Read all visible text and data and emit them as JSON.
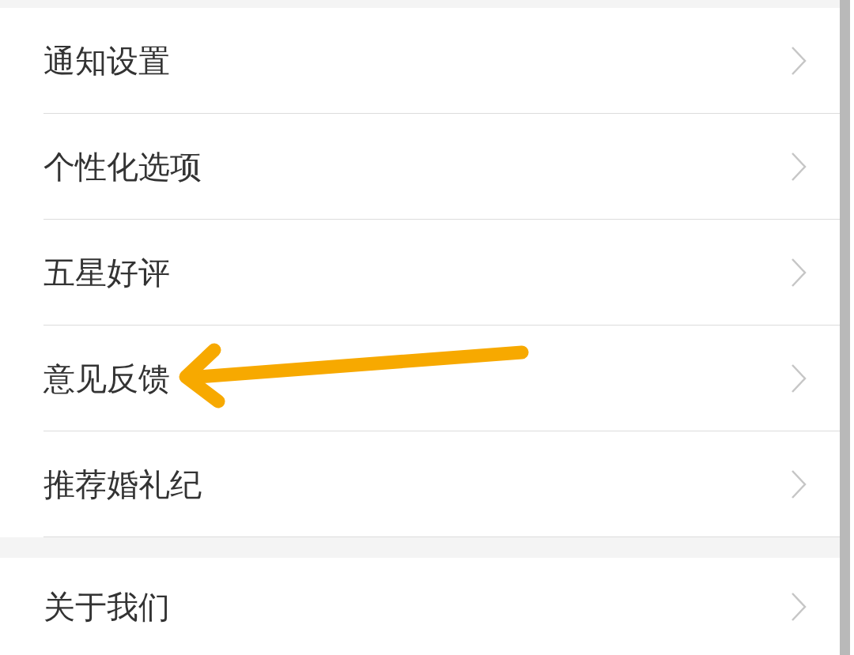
{
  "sections": [
    {
      "items": [
        {
          "label": "通知设置",
          "marked": false
        },
        {
          "label": "个性化选项",
          "marked": false
        },
        {
          "label": "五星好评",
          "marked": false
        },
        {
          "label": "意见反馈",
          "marked": true
        },
        {
          "label": "推荐婚礼纪",
          "marked": false
        }
      ]
    },
    {
      "items": [
        {
          "label": "关于我们",
          "marked": false
        }
      ]
    }
  ]
}
